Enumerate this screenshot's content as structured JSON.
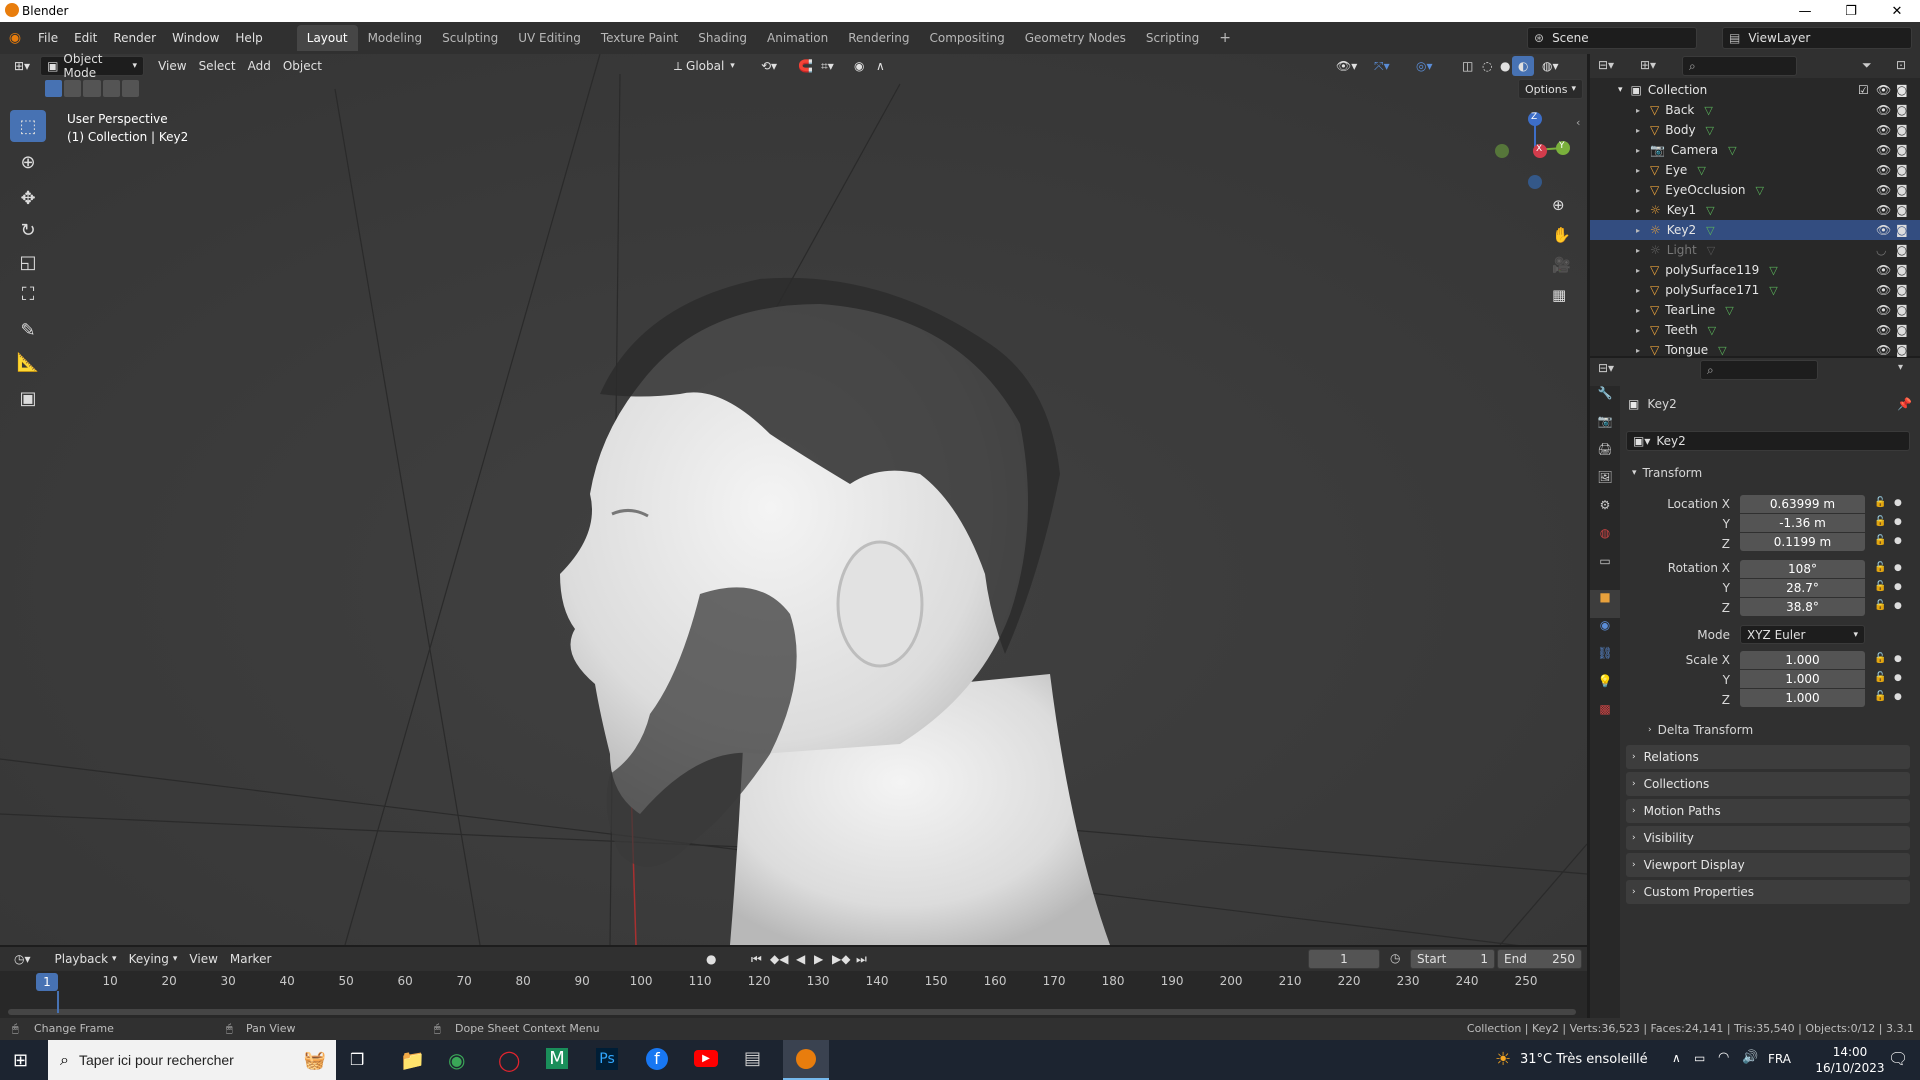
{
  "window": {
    "title": "Blender"
  },
  "menu": [
    "File",
    "Edit",
    "Render",
    "Window",
    "Help"
  ],
  "workspaces": [
    "Layout",
    "Modeling",
    "Sculpting",
    "UV Editing",
    "Texture Paint",
    "Shading",
    "Animation",
    "Rendering",
    "Compositing",
    "Geometry Nodes",
    "Scripting"
  ],
  "active_workspace": "Layout",
  "scene": {
    "name": "Scene",
    "view_layer": "ViewLayer"
  },
  "viewport": {
    "mode": "Object Mode",
    "menus": [
      "View",
      "Select",
      "Add",
      "Object"
    ],
    "orientation": "Global",
    "options_label": "Options",
    "info_line1": "User Perspective",
    "info_line2": "(1) Collection | Key2",
    "gizmo": {
      "x": "X",
      "y": "Y",
      "z": "Z"
    }
  },
  "outliner": {
    "collection": "Collection",
    "items": [
      "Back",
      "Body",
      "Camera",
      "Eye",
      "EyeOcclusion",
      "Key1",
      "Key2",
      "Light",
      "polySurface119",
      "polySurface171",
      "TearLine",
      "Teeth",
      "Tongue"
    ]
  },
  "properties": {
    "object_name": "Key2",
    "data_name": "Key2",
    "transform_label": "Transform",
    "location_label": "Location X",
    "location": [
      "0.63999 m",
      "-1.36 m",
      "0.1199 m"
    ],
    "rotation_label": "Rotation X",
    "rotation": [
      "108°",
      "28.7°",
      "38.8°"
    ],
    "mode_label": "Mode",
    "mode_value": "XYZ Euler",
    "scale_label": "Scale X",
    "scale": [
      "1.000",
      "1.000",
      "1.000"
    ],
    "axis_y": "Y",
    "axis_z": "Z",
    "delta_transform": "Delta Transform",
    "panels": [
      "Relations",
      "Collections",
      "Motion Paths",
      "Visibility",
      "Viewport Display",
      "Custom Properties"
    ]
  },
  "timeline": {
    "menus": [
      "Playback",
      "Keying",
      "View",
      "Marker"
    ],
    "current_frame": "1",
    "start_label": "Start",
    "start": "1",
    "end_label": "End",
    "end": "250",
    "ticks": [
      "10",
      "20",
      "30",
      "40",
      "50",
      "60",
      "70",
      "80",
      "90",
      "100",
      "110",
      "120",
      "130",
      "140",
      "150",
      "160",
      "170",
      "180",
      "190",
      "200",
      "210",
      "220",
      "230",
      "240",
      "250"
    ],
    "playhead": "1"
  },
  "status": {
    "left1": "Change Frame",
    "left2": "Pan View",
    "left3": "Dope Sheet Context Menu",
    "right": "Collection | Key2 | Verts:36,523 | Faces:24,141 | Tris:35,540 | Objects:0/12 | 3.3.1"
  },
  "taskbar": {
    "search_placeholder": "Taper ici pour rechercher",
    "weather": "31°C  Très ensoleillé",
    "lang": "FRA",
    "time": "14:00",
    "date": "16/10/2023"
  },
  "colors": {
    "accent": "#4772b3",
    "viewport_bg": "#3c3c3c",
    "panel_bg": "#303030",
    "outliner_bg": "#282828"
  }
}
